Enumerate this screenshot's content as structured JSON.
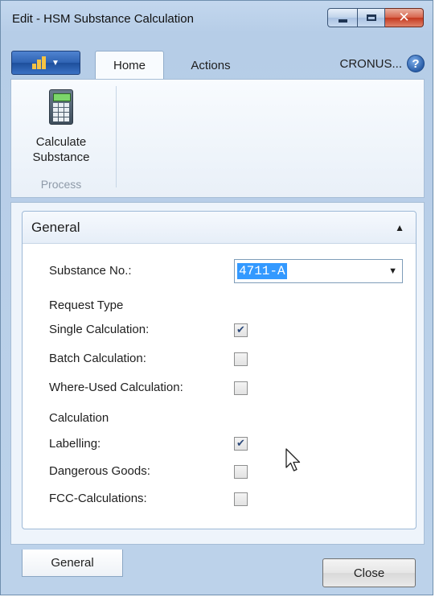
{
  "window": {
    "title": "Edit - HSM Substance Calculation"
  },
  "ribbon": {
    "tabs": [
      {
        "label": "Home"
      },
      {
        "label": "Actions"
      }
    ],
    "company": "CRONUS...",
    "buttons": [
      {
        "label_line1": "Calculate",
        "label_line2": "Substance",
        "icon": "calculator-icon"
      }
    ],
    "group_label": "Process"
  },
  "general": {
    "title": "General",
    "substance_no_label": "Substance No.:",
    "substance_no_value": "4711-A",
    "request_type_heading": "Request Type",
    "single_calc_label": "Single Calculation:",
    "single_calc_checked": true,
    "batch_calc_label": "Batch Calculation:",
    "batch_calc_checked": false,
    "where_used_label": "Where-Used Calculation:",
    "where_used_checked": false,
    "calculation_heading": "Calculation",
    "labelling_label": "Labelling:",
    "labelling_checked": true,
    "dangerous_goods_label": "Dangerous Goods:",
    "dangerous_goods_checked": false,
    "fcc_label": "FCC-Calculations:",
    "fcc_checked": false
  },
  "footer": {
    "tab_label": "General",
    "close_label": "Close"
  },
  "colors": {
    "selection": "#3399ff",
    "frame": "#bcd2ea",
    "close_button": "#c4391f"
  }
}
